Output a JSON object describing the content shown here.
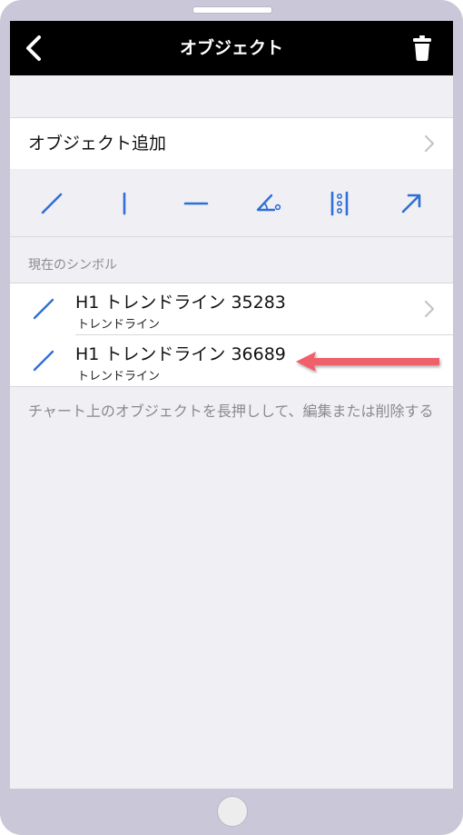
{
  "navbar": {
    "title": "オブジェクト",
    "back_icon": "chevron-left-icon",
    "trash_icon": "trash-icon"
  },
  "add_object": {
    "label": "オブジェクト追加",
    "chevron_icon": "chevron-right-icon"
  },
  "tools": [
    {
      "name": "trendline-tool",
      "icon": "diagonal-line-icon"
    },
    {
      "name": "vertical-line-tool",
      "icon": "vertical-line-icon"
    },
    {
      "name": "horizontal-line-tool",
      "icon": "horizontal-line-icon"
    },
    {
      "name": "angle-trendline-tool",
      "icon": "angle-icon"
    },
    {
      "name": "cycle-lines-tool",
      "icon": "cycle-lines-icon"
    },
    {
      "name": "arrow-tool",
      "icon": "arrow-up-right-icon"
    }
  ],
  "section": {
    "header": "現在のシンボル"
  },
  "objects": [
    {
      "title": "H1 トレンドライン 35283",
      "subtitle": "トレンドライン"
    },
    {
      "title": "H1 トレンドライン 36689",
      "subtitle": "トレンドライン"
    }
  ],
  "footer_note": "チャート上のオブジェクトを長押しして、編集または削除する",
  "colors": {
    "accent": "#2f6fd6",
    "navbar": "#000000",
    "background": "#efeff4",
    "annotation_arrow": "#f0606a"
  }
}
